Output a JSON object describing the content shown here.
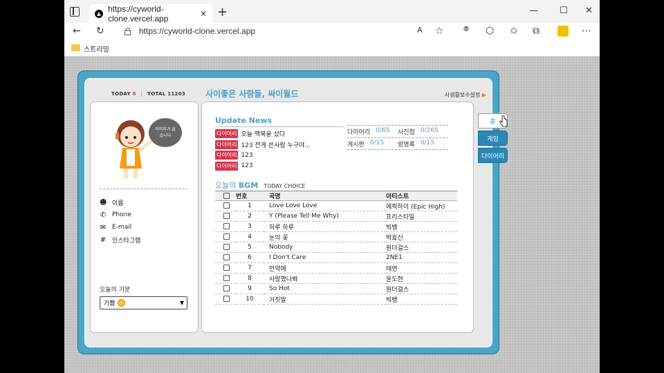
{
  "browser": {
    "tab_title": "https://cyworld-clone.vercel.app",
    "tab_close": "✕",
    "new_tab": "+",
    "address": "https://cyworld-clone.vercel.app",
    "bookmark": "스트리밍",
    "window_controls": {
      "minimize": "—",
      "maximize": "☐",
      "close": "✕"
    }
  },
  "header": {
    "today_label": "TODAY",
    "today_count": "8",
    "total_label": "TOTAL 11203",
    "homepage_title": "사이좋은 사람들, 싸이월드",
    "settings_label": "사생활보수설정",
    "settings_arrow": "▶"
  },
  "profile": {
    "speech_bubble": "이미지가 없습니다",
    "info": [
      {
        "icon": "smiley-icon",
        "glyph": "☻",
        "label": "이름"
      },
      {
        "icon": "phone-icon",
        "glyph": "✆",
        "label": "Phone"
      },
      {
        "icon": "mail-icon",
        "glyph": "✉",
        "label": "E-mail"
      },
      {
        "icon": "hashtag-icon",
        "glyph": "#",
        "label": "인스타그램"
      }
    ],
    "mood_label": "오늘의 기분",
    "mood_value": "기쁨",
    "mood_caret": "▼"
  },
  "updates": {
    "title": "Update News",
    "badge": "다이어리",
    "items": [
      "오늘 맥북을 샀다",
      "123 전게 쓴사람 누구야...",
      "123",
      "123"
    ]
  },
  "stats": [
    [
      {
        "label": "다이어리",
        "value": "0/65"
      },
      {
        "label": "사진첩",
        "value": "0/265"
      }
    ],
    [
      {
        "label": "게시판",
        "value": "0/15"
      },
      {
        "label": "방명록",
        "value": "0/15"
      }
    ]
  ],
  "bgm": {
    "title_light": "오늘의 ",
    "title_bold": "BGM",
    "subtitle": "TODAY CHOICE",
    "headers": {
      "num": "번호",
      "song": "곡명",
      "artist": "아티스트"
    },
    "rows": [
      {
        "num": "1",
        "song": "Love Love Love",
        "artist": "에픽하이 (Epic High)"
      },
      {
        "num": "2",
        "song": "Y (Please Tell Me Why)",
        "artist": "프리스타일"
      },
      {
        "num": "3",
        "song": "하루 하루",
        "artist": "빅뱅"
      },
      {
        "num": "4",
        "song": "눈의 꽃",
        "artist": "박효신"
      },
      {
        "num": "5",
        "song": "Nobody",
        "artist": "원더걸스"
      },
      {
        "num": "6",
        "song": "I Don't Care",
        "artist": "2NE1"
      },
      {
        "num": "7",
        "song": "만약에",
        "artist": "태연"
      },
      {
        "num": "8",
        "song": "사랑했나봐",
        "artist": "윤도현"
      },
      {
        "num": "9",
        "song": "So Hot",
        "artist": "원더걸스"
      },
      {
        "num": "10",
        "song": "거짓말",
        "artist": "빅뱅"
      }
    ]
  },
  "side_tabs": {
    "home": "홈",
    "game": "게임",
    "diary": "다이어리"
  },
  "colors": {
    "frame": "#49a6c9",
    "accent": "#4d9dc9",
    "badge": "#d8334a",
    "tab_active": "#2c88b6"
  }
}
